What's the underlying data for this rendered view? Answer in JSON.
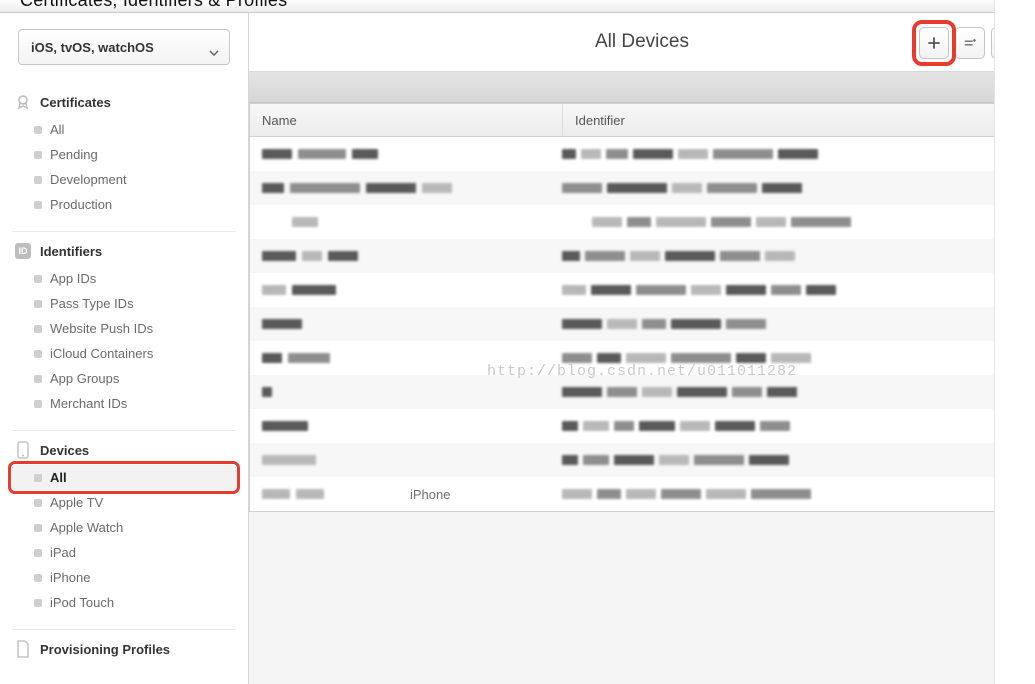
{
  "header": {
    "title": "Certificates, Identifiers & Profiles"
  },
  "platform_selector": {
    "label": "iOS, tvOS, watchOS"
  },
  "sidebar": {
    "sections": [
      {
        "title": "Certificates",
        "icon": "ribbon-icon",
        "items": [
          {
            "label": "All"
          },
          {
            "label": "Pending"
          },
          {
            "label": "Development"
          },
          {
            "label": "Production"
          }
        ]
      },
      {
        "title": "Identifiers",
        "icon": "id-badge-icon",
        "items": [
          {
            "label": "App IDs"
          },
          {
            "label": "Pass Type IDs"
          },
          {
            "label": "Website Push IDs"
          },
          {
            "label": "iCloud Containers"
          },
          {
            "label": "App Groups"
          },
          {
            "label": "Merchant IDs"
          }
        ]
      },
      {
        "title": "Devices",
        "icon": "device-icon",
        "selected_index": 0,
        "items": [
          {
            "label": "All"
          },
          {
            "label": "Apple TV"
          },
          {
            "label": "Apple Watch"
          },
          {
            "label": "iPad"
          },
          {
            "label": "iPhone"
          },
          {
            "label": "iPod Touch"
          }
        ]
      },
      {
        "title": "Provisioning Profiles",
        "icon": "doc-icon",
        "items": []
      }
    ]
  },
  "content": {
    "title": "All Devices",
    "toolbar": {
      "add": "+",
      "edit": "edit",
      "search": "search"
    },
    "columns": {
      "name": "Name",
      "identifier": "Identifier"
    },
    "visible_row_text": {
      "row10_name": "iPhone"
    },
    "row_count": 11
  },
  "watermark": "http://blog.csdn.net/u011011282"
}
